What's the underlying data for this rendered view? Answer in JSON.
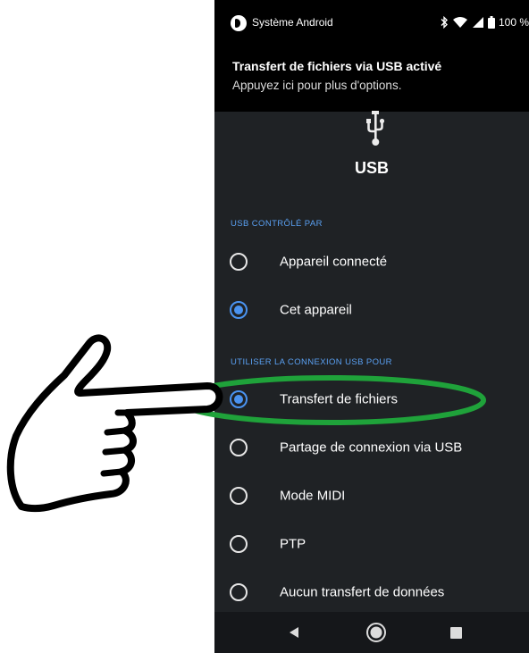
{
  "status_bar": {
    "app_name": "Système Android",
    "battery_text": "100 %",
    "icons": [
      "system-app-icon",
      "bluetooth-icon",
      "wifi-icon",
      "signal-icon",
      "battery-icon"
    ]
  },
  "notification": {
    "title": "Transfert de fichiers via USB activé",
    "subtitle": "Appuyez ici pour plus d'options."
  },
  "header": {
    "icon": "usb-icon",
    "title": "USB"
  },
  "sections": [
    {
      "title": "USB CONTRÔLÉ PAR",
      "options": [
        {
          "label": "Appareil connecté",
          "selected": false
        },
        {
          "label": "Cet appareil",
          "selected": true
        }
      ]
    },
    {
      "title": "UTILISER LA CONNEXION USB POUR",
      "options": [
        {
          "label": "Transfert de fichiers",
          "selected": true
        },
        {
          "label": "Partage de connexion via USB",
          "selected": false
        },
        {
          "label": "Mode MIDI",
          "selected": false
        },
        {
          "label": "PTP",
          "selected": false
        },
        {
          "label": "Aucun transfert de données",
          "selected": false
        }
      ]
    }
  ],
  "nav_bar": {
    "buttons": [
      "back-icon",
      "home-icon",
      "recents-icon"
    ]
  },
  "annotations": {
    "highlight_color": "#1fa23a",
    "pointer": "pointing-hand-icon"
  },
  "colors": {
    "background": "#1f2225",
    "accent": "#4a93f0",
    "section_header": "#5aa0f2"
  }
}
